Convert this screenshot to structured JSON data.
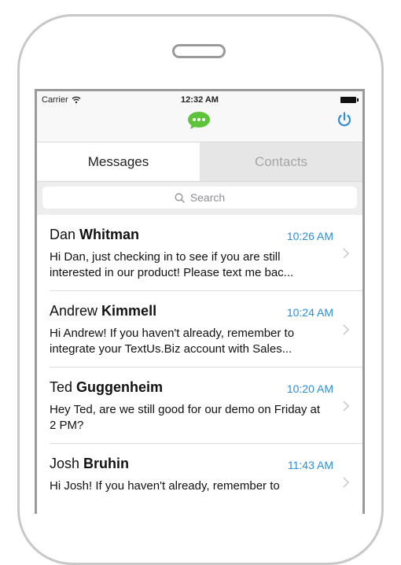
{
  "status_bar": {
    "carrier": "Carrier",
    "time": "12:32 AM"
  },
  "nav": {
    "logo_icon": "chat-bubble-icon",
    "power_icon": "power-icon",
    "accent_color": "#2d8ed6",
    "logo_color": "#5cc33a"
  },
  "tabs": [
    {
      "label": "Messages",
      "active": true
    },
    {
      "label": "Contacts",
      "active": false
    }
  ],
  "search": {
    "placeholder": "Search"
  },
  "messages": [
    {
      "first": "Dan",
      "last": "Whitman",
      "time": "10:26 AM",
      "text": "Hi Dan, just checking in to see if you are still interested in our product! Please text me bac..."
    },
    {
      "first": "Andrew",
      "last": "Kimmell",
      "time": "10:24 AM",
      "text": "Hi Andrew! If you haven't already, remember to integrate your TextUs.Biz account with Sales..."
    },
    {
      "first": "Ted",
      "last": "Guggenheim",
      "time": "10:20 AM",
      "text": "Hey Ted, are we still good for our demo on Friday at 2 PM?"
    },
    {
      "first": "Josh",
      "last": "Bruhin",
      "time": "11:43 AM",
      "text": "Hi Josh! If you haven't already, remember to"
    }
  ]
}
